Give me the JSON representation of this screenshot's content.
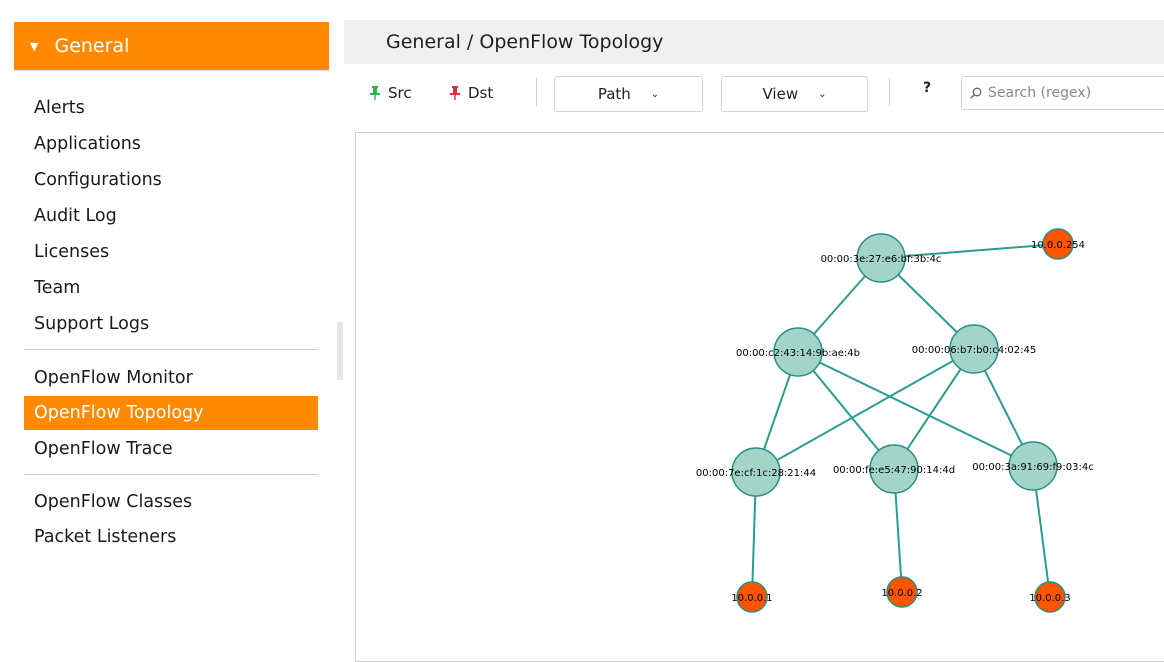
{
  "sidebar": {
    "header": "General",
    "groups": [
      [
        "Alerts",
        "Applications",
        "Configurations",
        "Audit Log",
        "Licenses",
        "Team",
        "Support Logs"
      ],
      [
        "OpenFlow Monitor",
        "OpenFlow Topology",
        "OpenFlow Trace"
      ],
      [
        "OpenFlow Classes",
        "Packet Listeners"
      ]
    ],
    "active": "OpenFlow Topology"
  },
  "page": {
    "title": "General / OpenFlow Topology"
  },
  "toolbar": {
    "src_label": "Src",
    "dst_label": "Dst",
    "path_label": "Path",
    "view_label": "View",
    "help_label": "?",
    "search_placeholder": "Search (regex)"
  },
  "colors": {
    "accent": "#ff8a00",
    "switch_fill": "#a3d4c8",
    "switch_stroke": "#2a8f83",
    "host_fill": "#ff5400",
    "link": "#2a9d8f",
    "src_pin": "#2db34a",
    "dst_pin": "#d9303a"
  },
  "topology": {
    "switches": [
      {
        "id": "s1",
        "label": "00:00:3e:27:e6:bf:3b:4c"
      },
      {
        "id": "s2",
        "label": "00:00:c2:43:14:9b:ae:4b"
      },
      {
        "id": "s3",
        "label": "00:00:06:b7:b0:c4:02:45"
      },
      {
        "id": "s4",
        "label": "00:00:7e:cf:1c:28:21:44"
      },
      {
        "id": "s5",
        "label": "00:00:fe:e5:47:90:14:4d"
      },
      {
        "id": "s6",
        "label": "00:00:3a:91:69:f9:03:4c"
      }
    ],
    "hosts": [
      {
        "id": "h0",
        "label": "10.0.0.254"
      },
      {
        "id": "h1",
        "label": "10.0.0.1"
      },
      {
        "id": "h2",
        "label": "10.0.0.2"
      },
      {
        "id": "h3",
        "label": "10.0.0.3"
      }
    ],
    "links": [
      [
        "s1",
        "h0"
      ],
      [
        "s1",
        "s2"
      ],
      [
        "s1",
        "s3"
      ],
      [
        "s2",
        "s4"
      ],
      [
        "s2",
        "s5"
      ],
      [
        "s2",
        "s6"
      ],
      [
        "s3",
        "s4"
      ],
      [
        "s3",
        "s5"
      ],
      [
        "s3",
        "s6"
      ],
      [
        "s4",
        "h1"
      ],
      [
        "s5",
        "h2"
      ],
      [
        "s6",
        "h3"
      ]
    ]
  }
}
